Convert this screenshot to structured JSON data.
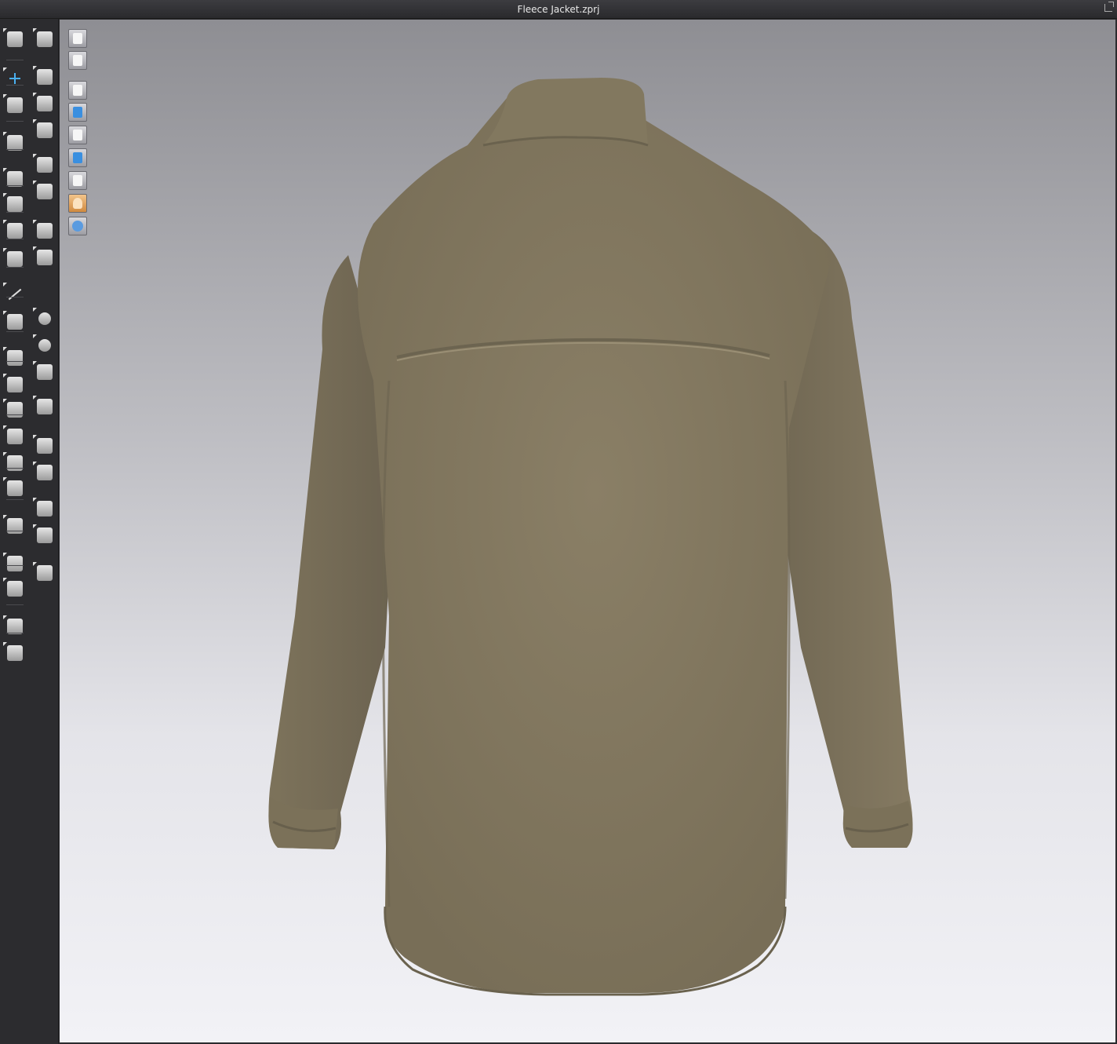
{
  "window": {
    "title": "Fleece Jacket.zprj"
  },
  "toolbar_left": {
    "column1": [
      {
        "icon": "simulate-icon"
      },
      {
        "icon": "transform-pattern-icon"
      },
      {
        "icon": "edit-curvature-icon"
      },
      {
        "icon": "garment-fold-icon"
      },
      {
        "icon": "seam-taping-icon"
      },
      {
        "icon": "measure-icon"
      },
      {
        "icon": "tack-icon"
      },
      {
        "icon": "zipper-icon"
      },
      {
        "icon": "line-icon"
      },
      {
        "icon": "camera-icon"
      },
      {
        "icon": "snapshot-icon"
      },
      {
        "icon": "arrangement-icon"
      },
      {
        "icon": "shirt-icon"
      },
      {
        "icon": "pants-icon"
      },
      {
        "icon": "avatar-pose-icon"
      },
      {
        "icon": "avatar-icon"
      },
      {
        "icon": "fit-map-icon"
      },
      {
        "icon": "ruler-icon"
      },
      {
        "icon": "tape-measure-icon"
      },
      {
        "icon": "garment-front-icon"
      },
      {
        "icon": "garment-back-icon"
      }
    ],
    "column2": [
      {
        "icon": "walk-pose-icon"
      },
      {
        "icon": "select-mesh-icon"
      },
      {
        "icon": "pin-icon"
      },
      {
        "icon": "stitch-icon"
      },
      {
        "icon": "sewing-icon"
      },
      {
        "icon": "needle-icon"
      },
      {
        "icon": "fabric-brush-icon"
      },
      {
        "icon": "texture-icon"
      },
      {
        "icon": "button-icon"
      },
      {
        "icon": "buttonhole-icon"
      },
      {
        "icon": "lock-button-icon"
      },
      {
        "icon": "zipper-slider-icon"
      },
      {
        "icon": "block-icon"
      },
      {
        "icon": "panel-icon"
      },
      {
        "icon": "gradient-icon"
      },
      {
        "icon": "tiling-icon"
      },
      {
        "icon": "split-icon"
      }
    ]
  },
  "viewport_toolbar": [
    {
      "icon": "show-avatar-icon"
    },
    {
      "icon": "show-garment-icon"
    },
    {
      "icon": "show-3d-pattern-icon"
    },
    {
      "icon": "show-pin-icon"
    },
    {
      "icon": "show-avatar-body-icon"
    },
    {
      "icon": "show-fabric-icon"
    },
    {
      "icon": "show-eraser-icon"
    },
    {
      "icon": "show-skin-icon"
    },
    {
      "icon": "show-environment-icon"
    }
  ],
  "colors": {
    "garment": "#877c63",
    "garment_shadow": "#6f6650",
    "viewport_top": "#8e8e93",
    "viewport_bottom": "#f2f2f6"
  }
}
